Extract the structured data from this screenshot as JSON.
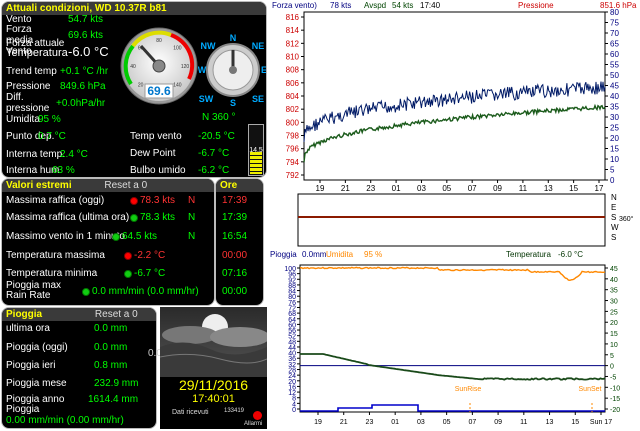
{
  "current": {
    "title": "Attuali condizioni, WD 10.37R b81",
    "rows": [
      {
        "label": "Vento",
        "value": "54.7 kts"
      },
      {
        "label": "Forza media Vento",
        "value": "69.6 kts"
      },
      {
        "label": "Forza attuale",
        "value": ""
      },
      {
        "label": "Temperatura",
        "value": "-6.0 °C"
      },
      {
        "label": "Trend temp",
        "value": "+0.1 °C /hr"
      },
      {
        "label": "Pressione",
        "value": "849.6 hPa"
      },
      {
        "label": "Diff. pressione",
        "value": "+0.0hPa/hr"
      },
      {
        "label": "Umidita",
        "value": "95 %"
      },
      {
        "label": "Punto dep.",
        "value": "0.7 °C"
      },
      {
        "label": "Interna temp.",
        "value": "2.4 °C"
      },
      {
        "label": "Interna hum",
        "value": "63 %"
      }
    ],
    "right_rows": [
      {
        "label": "Temp vento",
        "value": "-20.5 °C"
      },
      {
        "label": "Dew Point",
        "value": "-6.7 °C"
      },
      {
        "label": "Bulbo umido",
        "value": "-6.2 °C"
      }
    ],
    "gauge_value": "69.6",
    "gauge_ticks": [
      "20",
      "40",
      "60",
      "80",
      "100",
      "120",
      "140"
    ],
    "compass": {
      "n": "N",
      "ne": "NE",
      "e": "E",
      "se": "SE",
      "s": "S",
      "sw": "SW",
      "w": "W",
      "nw": "NW"
    },
    "direction": "N  360 °",
    "battery_label": "14.5"
  },
  "extremes": {
    "title": "Valori estremi",
    "reset": "Reset a 0",
    "time_title": "Ore",
    "rows": [
      {
        "label": "Massima raffica (oggi)",
        "value": "78.3 kts",
        "dir": "N",
        "time": "17:39",
        "red": true
      },
      {
        "label": "Massima raffica (ultima ora)",
        "value": "78.3 kts",
        "dir": "N",
        "time": "17:39",
        "red": false
      },
      {
        "label": "Massimo vento in 1 minuto",
        "value": "64.5 kts",
        "dir": "N",
        "time": "16:54",
        "red": false
      },
      {
        "label": "Temperatura massima",
        "value": "-2.2 °C",
        "dir": "",
        "time": "00:00",
        "red": true
      },
      {
        "label": "Temperatura minima",
        "value": "-6.7 °C",
        "dir": "",
        "time": "07:16",
        "red": false
      },
      {
        "label": "Pioggia max Rain Rate",
        "value": "0.0 mm/min (0.0 mm/hr)",
        "dir": "",
        "time": "00:00",
        "red": false
      }
    ]
  },
  "rain": {
    "title": "Pioggia",
    "reset": "Reset a 0",
    "rows": [
      {
        "label": "ultima ora",
        "value": "0.0 mm"
      },
      {
        "label": "Pioggia (oggi)",
        "value": "0.0 mm"
      },
      {
        "label": "Pioggia ieri",
        "value": "0.8 mm"
      },
      {
        "label": "Pioggia mese",
        "value": "232.9 mm"
      },
      {
        "label": "Pioggia anno",
        "value": "1614.4 mm"
      },
      {
        "label": "Pioggia",
        "value": ""
      }
    ],
    "rate": "0.00 mm/min (0.00 mm/hr)",
    "side_value": "0.0"
  },
  "clock": {
    "date": "29/11/2016",
    "time": "17:40:01",
    "received_label": "Dati ricevuti",
    "received_count": "133419",
    "alarm_label": "Allarmi"
  },
  "chart_top": {
    "title_left": "Forza vento)",
    "avg_label": "78 kts",
    "gust_label": "Avspd",
    "gust_value": "54 kts",
    "time": "17:40",
    "pressure_label": "Pressione",
    "pressure_value": "851.6 hPa",
    "left_ticks": [
      "816",
      "814",
      "812",
      "810",
      "808",
      "806",
      "804",
      "802",
      "800",
      "798",
      "796",
      "794",
      "792"
    ],
    "right_ticks": [
      "80",
      "75",
      "70",
      "65",
      "60",
      "55",
      "50",
      "45",
      "40",
      "35",
      "30",
      "25",
      "20",
      "15",
      "10",
      "5",
      "0"
    ],
    "x_ticks": [
      "19",
      "21",
      "23",
      "01",
      "03",
      "05",
      "07",
      "09",
      "11",
      "13",
      "15",
      "17"
    ]
  },
  "chart_dir": {
    "labels": [
      "N",
      "E",
      "S",
      "W",
      "S"
    ],
    "n360": "360°"
  },
  "chart_bottom": {
    "rain_label": "Pioggia",
    "rain_value": "0.0mm",
    "hum_label": "Umidita",
    "hum_value": "95 %",
    "temp_label": "Temperatura",
    "temp_value": "-6.0 °C",
    "left_ticks": [
      "100",
      "96",
      "92",
      "88",
      "84",
      "80",
      "76",
      "72",
      "68",
      "64",
      "60",
      "56",
      "52",
      "48",
      "44",
      "40",
      "36",
      "32",
      "28",
      "24",
      "20",
      "16",
      "12",
      "8",
      "4",
      "0"
    ],
    "right_ticks": [
      "45",
      "40",
      "35",
      "30",
      "25",
      "20",
      "15",
      "10",
      "5",
      "0",
      "-5",
      "-10",
      "-15",
      "-20"
    ],
    "x_ticks": [
      "19",
      "21",
      "23",
      "01",
      "03",
      "05",
      "07",
      "09",
      "11",
      "13",
      "15",
      "Sun 17"
    ],
    "sunrise": "SunRise",
    "sunset": "SunSet"
  },
  "colors": {
    "panel_title": "#ffff00",
    "value": "#00ff00",
    "alert": "#ff3333",
    "wind_avg": "#001a66",
    "wind_gust": "#004400",
    "humidity": "#ff8800",
    "temperature": "#003300"
  }
}
